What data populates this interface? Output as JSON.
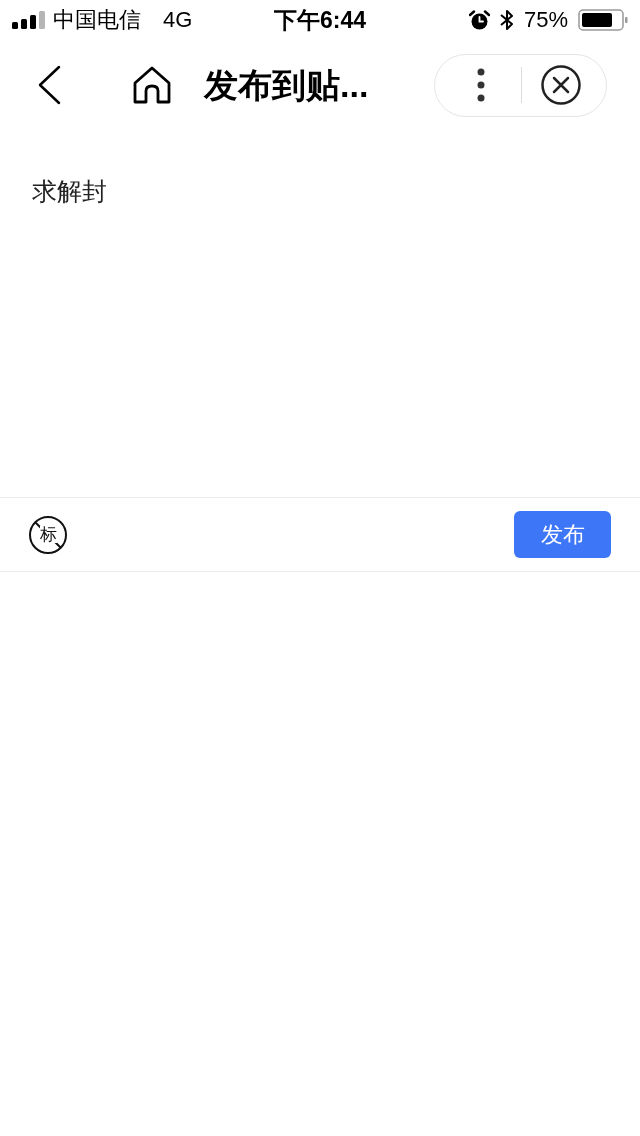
{
  "status_bar": {
    "carrier": "中国电信",
    "network": "4G",
    "time": "下午6:44",
    "battery": "75%"
  },
  "nav_bar": {
    "title": "发布到贴..."
  },
  "editor": {
    "value": "求解封"
  },
  "toolbar": {
    "title_toggle": {
      "glyph": "标",
      "on": false
    },
    "publish_button": "发布"
  }
}
